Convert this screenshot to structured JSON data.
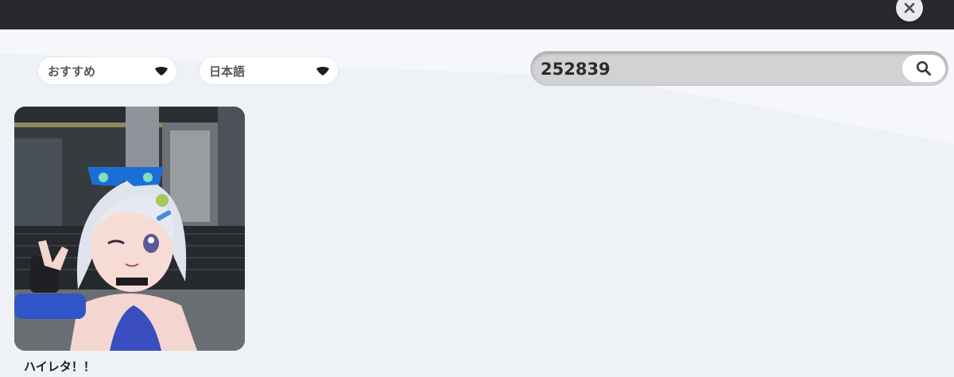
{
  "header": {
    "close_icon": "close-icon"
  },
  "filters": {
    "sort": {
      "label": "おすすめ",
      "icon": "caret-down-icon"
    },
    "language": {
      "label": "日本語",
      "icon": "caret-down-icon"
    }
  },
  "search": {
    "value": "252839",
    "icon": "search-icon"
  },
  "results": [
    {
      "title": "ハイレタ！！",
      "thumbnail": "avatar-thumbnail"
    }
  ],
  "colors": {
    "topbar": "#27292d",
    "background": "#eef1f6",
    "search_bg": "#d2d2d4"
  }
}
